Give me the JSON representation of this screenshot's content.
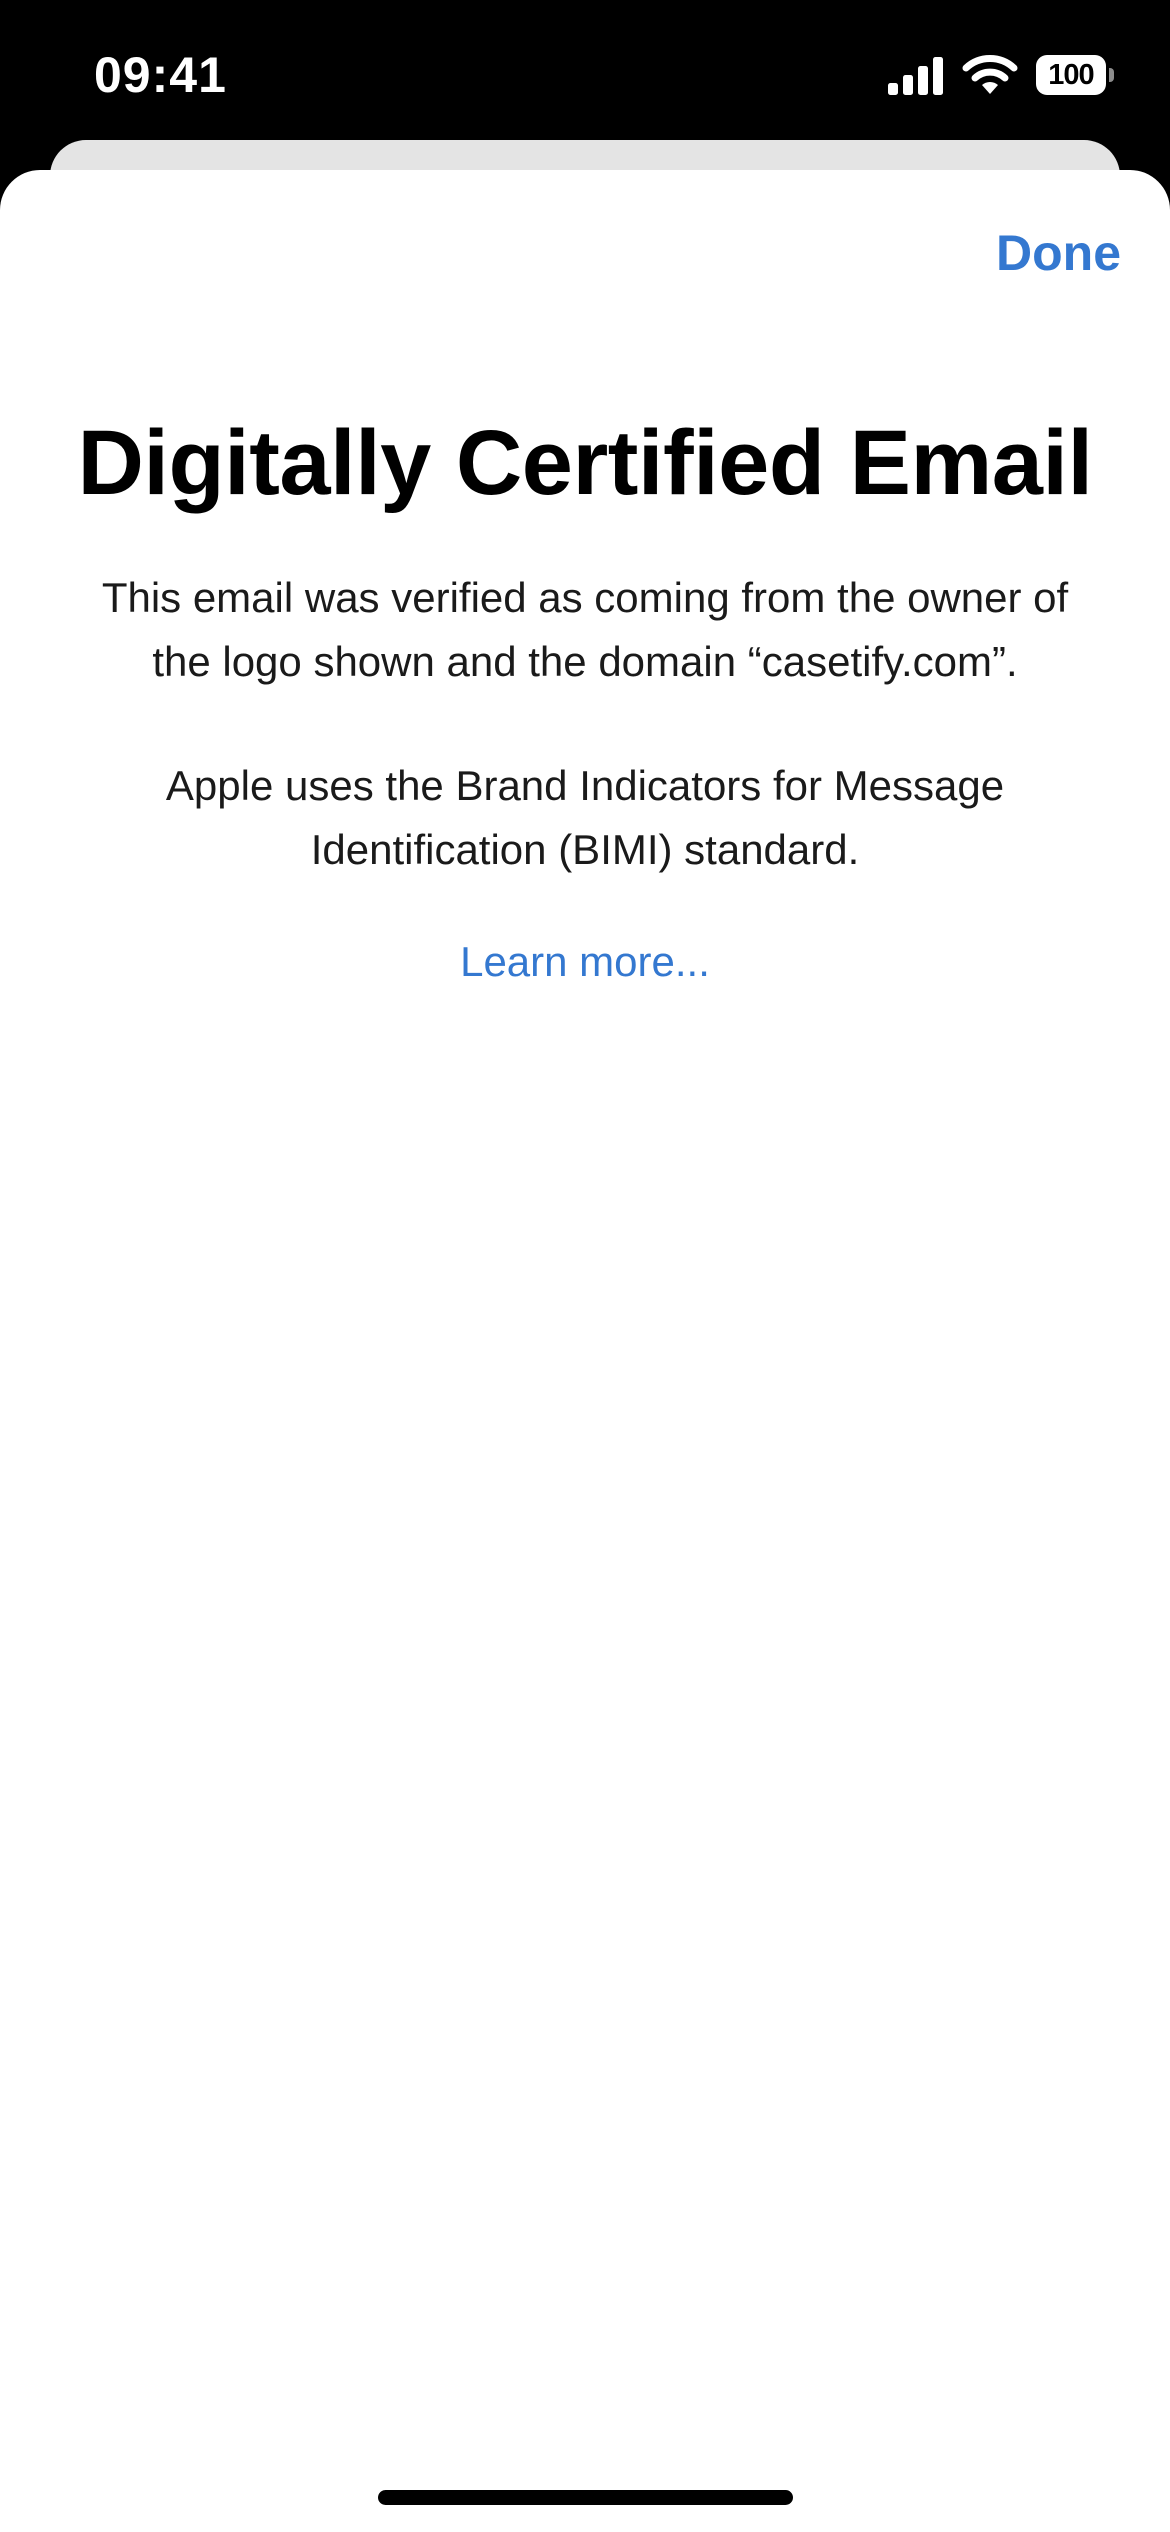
{
  "status_bar": {
    "time": "09:41",
    "battery_level": "100",
    "icons": [
      "signal-icon",
      "wifi-icon",
      "battery-icon"
    ]
  },
  "sheet": {
    "done_label": "Done",
    "title": "Digitally Certified Email",
    "description_1": "This email was verified as coming from the owner of the logo shown and the domain “casetify.com”.",
    "description_2": "Apple uses the Brand Indicators for Message Identification (BIMI) standard.",
    "learn_more_label": "Learn more..."
  },
  "colors": {
    "accent": "#3478d0",
    "background": "#ffffff",
    "status_bar_background": "#000000"
  }
}
